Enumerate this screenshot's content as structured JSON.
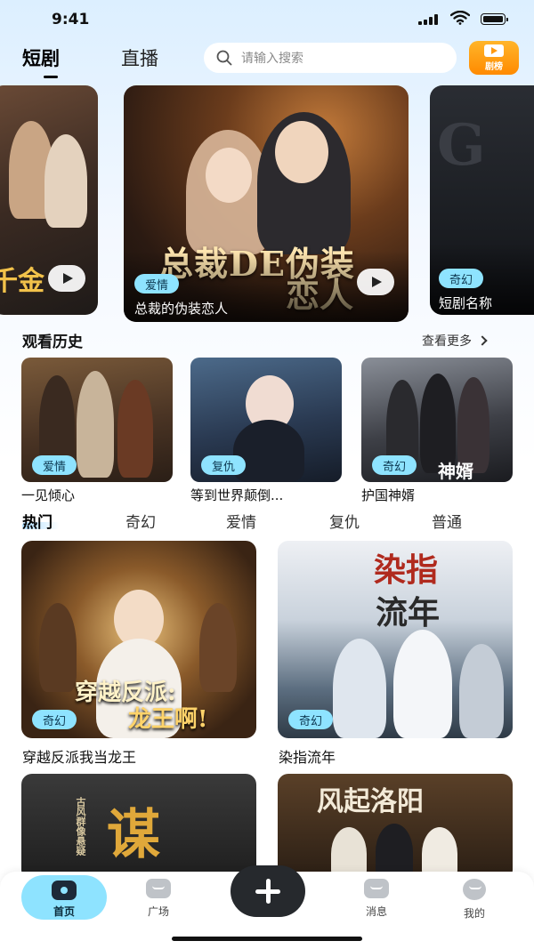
{
  "status_bar": {
    "time": "9:41"
  },
  "header": {
    "tabs": [
      "短剧",
      "直播"
    ],
    "active_tab": "短剧",
    "search_placeholder": "请输入搜索",
    "rank_label": "剧榜"
  },
  "banners": [
    {
      "title_art": "千金",
      "position": "left"
    },
    {
      "tag": "爱情",
      "caption": "总裁的伪装恋人",
      "art_line1": "总裁DE伪装",
      "art_line2": "恋人"
    },
    {
      "tag": "奇幻",
      "caption": "短剧名称",
      "art": "G"
    }
  ],
  "history": {
    "title": "观看历史",
    "see_more": "查看更多",
    "items": [
      {
        "tag": "爱情",
        "title": "一见倾心"
      },
      {
        "tag": "复仇",
        "title": "等到世界颠倒..."
      },
      {
        "tag": "奇幻",
        "title": "护国神婿",
        "art": "神婿"
      }
    ]
  },
  "categories": [
    "热门",
    "奇幻",
    "爱情",
    "复仇",
    "普通"
  ],
  "active_category": "热门",
  "grid": [
    {
      "tag": "奇幻",
      "title": "穿越反派我当龙王",
      "art_line1": "穿越反派:",
      "art_line2": "龙王啊!"
    },
    {
      "tag": "奇幻",
      "title": "染指流年",
      "art_line1": "染指",
      "art_line2": "流年"
    },
    {
      "art": "谋",
      "sub": "古风群像悬疑"
    },
    {
      "art": "风起洛阳"
    }
  ],
  "bottom_nav": {
    "items": [
      "首页",
      "广场",
      "消息",
      "我的"
    ],
    "active": "首页"
  },
  "colors": {
    "accent": "#8ee3ff",
    "rank_orange": "#ff9a10",
    "dark": "#26292d"
  }
}
